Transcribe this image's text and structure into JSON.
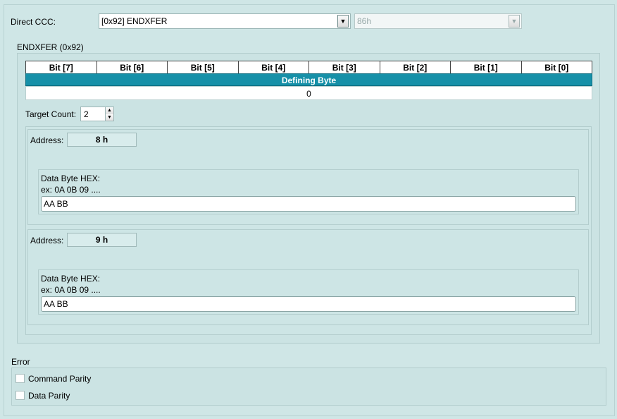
{
  "direct_ccc": {
    "label": "Direct CCC:",
    "selected": "[0x92] ENDXFER",
    "secondary_value": "86h"
  },
  "panel": {
    "title": "ENDXFER (0x92)",
    "bit_headers": [
      "Bit [7]",
      "Bit [6]",
      "Bit [5]",
      "Bit [4]",
      "Bit [3]",
      "Bit [2]",
      "Bit [1]",
      "Bit [0]"
    ],
    "defining_byte_label": "Defining Byte",
    "defining_byte_value": "0",
    "target_count_label": "Target Count:",
    "target_count_value": "2",
    "targets": [
      {
        "address_label": "Address:",
        "address_value": "8 h",
        "data_label": "Data Byte HEX:",
        "data_example": "ex: 0A 0B 09 ....",
        "data_value": "AA BB"
      },
      {
        "address_label": "Address:",
        "address_value": "9 h",
        "data_label": "Data Byte HEX:",
        "data_example": "ex: 0A 0B 09 ....",
        "data_value": "AA BB"
      }
    ]
  },
  "error": {
    "title": "Error",
    "items": [
      {
        "label": "Command Parity",
        "checked": false
      },
      {
        "label": "Data Parity",
        "checked": false
      }
    ]
  },
  "icons": {
    "dropdown": "chevron-down-icon",
    "spin_up": "arrow-up-icon",
    "spin_down": "arrow-down-icon"
  },
  "colors": {
    "background": "#cfe6e6",
    "defining_byte_bar": "#1690a8"
  }
}
